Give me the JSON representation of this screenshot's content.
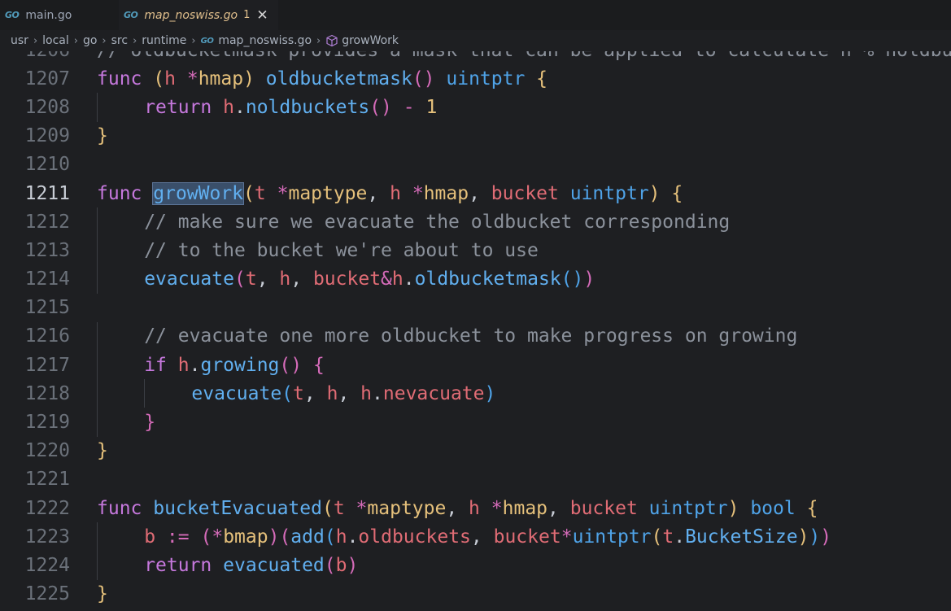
{
  "tabs": [
    {
      "icon": "go-icon",
      "label": "main.go",
      "active": false
    },
    {
      "icon": "go-icon",
      "label": "map_noswiss.go",
      "active": true,
      "badge": "1"
    }
  ],
  "breadcrumb": [
    "usr",
    "local",
    "go",
    "src",
    "runtime",
    "map_noswiss.go",
    "growWork"
  ],
  "icon_text": "GO",
  "colors": {
    "background": "#1e1f22",
    "keyword": "#c678dd",
    "function": "#61afef",
    "type": "#e5c07b",
    "param": "#e06c75",
    "comment": "#8b919b"
  },
  "code": [
    {
      "n": "1206",
      "indent": 0,
      "tokens": [
        [
          "cm",
          "// oldbucketmask provides a mask that can be applied to calculate n % noldbuckets()."
        ]
      ]
    },
    {
      "n": "1207",
      "indent": 0,
      "tokens": [
        [
          "kw",
          "func"
        ],
        [
          "df",
          " "
        ],
        [
          "p1",
          "("
        ],
        [
          "pr",
          "h"
        ],
        [
          "df",
          " "
        ],
        [
          "op",
          "*"
        ],
        [
          "ty",
          "hmap"
        ],
        [
          "p1",
          ")"
        ],
        [
          "df",
          " "
        ],
        [
          "fn",
          "oldbucketmask"
        ],
        [
          "p2",
          "()"
        ],
        [
          "df",
          " "
        ],
        [
          "kwb",
          "uintptr"
        ],
        [
          "df",
          " "
        ],
        [
          "p1",
          "{"
        ]
      ]
    },
    {
      "n": "1208",
      "indent": 1,
      "tokens": [
        [
          "kw",
          "return"
        ],
        [
          "df",
          " "
        ],
        [
          "pr",
          "h"
        ],
        [
          "df",
          "."
        ],
        [
          "fn",
          "noldbuckets"
        ],
        [
          "p2",
          "()"
        ],
        [
          "df",
          " "
        ],
        [
          "op",
          "-"
        ],
        [
          "df",
          " "
        ],
        [
          "nm",
          "1"
        ]
      ]
    },
    {
      "n": "1209",
      "indent": 0,
      "tokens": [
        [
          "p1",
          "}"
        ]
      ]
    },
    {
      "n": "1210",
      "indent": 0,
      "tokens": []
    },
    {
      "n": "1211",
      "indent": 0,
      "current": true,
      "tokens": [
        [
          "kw",
          "func"
        ],
        [
          "df",
          " "
        ],
        [
          "fn hl",
          "growWork"
        ],
        [
          "p1",
          "("
        ],
        [
          "pr",
          "t"
        ],
        [
          "df",
          " "
        ],
        [
          "op",
          "*"
        ],
        [
          "ty",
          "maptype"
        ],
        [
          "df",
          ", "
        ],
        [
          "pr",
          "h"
        ],
        [
          "df",
          " "
        ],
        [
          "op",
          "*"
        ],
        [
          "ty",
          "hmap"
        ],
        [
          "df",
          ", "
        ],
        [
          "pr",
          "bucket"
        ],
        [
          "df",
          " "
        ],
        [
          "kwb",
          "uintptr"
        ],
        [
          "p1",
          ")"
        ],
        [
          "df",
          " "
        ],
        [
          "p1",
          "{"
        ]
      ]
    },
    {
      "n": "1212",
      "indent": 1,
      "tokens": [
        [
          "cm",
          "// make sure we evacuate the oldbucket corresponding"
        ]
      ]
    },
    {
      "n": "1213",
      "indent": 1,
      "tokens": [
        [
          "cm",
          "// to the bucket we're about to use"
        ]
      ]
    },
    {
      "n": "1214",
      "indent": 1,
      "tokens": [
        [
          "fn",
          "evacuate"
        ],
        [
          "p2",
          "("
        ],
        [
          "pr",
          "t"
        ],
        [
          "df",
          ", "
        ],
        [
          "pr",
          "h"
        ],
        [
          "df",
          ", "
        ],
        [
          "pr",
          "bucket"
        ],
        [
          "op",
          "&"
        ],
        [
          "pr",
          "h"
        ],
        [
          "df",
          "."
        ],
        [
          "fn",
          "oldbucketmask"
        ],
        [
          "p3",
          "()"
        ],
        [
          "p2",
          ")"
        ]
      ]
    },
    {
      "n": "1215",
      "indent": 0,
      "tokens": []
    },
    {
      "n": "1216",
      "indent": 1,
      "tokens": [
        [
          "cm",
          "// evacuate one more oldbucket to make progress on growing"
        ]
      ]
    },
    {
      "n": "1217",
      "indent": 1,
      "tokens": [
        [
          "kw",
          "if"
        ],
        [
          "df",
          " "
        ],
        [
          "pr",
          "h"
        ],
        [
          "df",
          "."
        ],
        [
          "fn",
          "growing"
        ],
        [
          "p2",
          "()"
        ],
        [
          "df",
          " "
        ],
        [
          "p2",
          "{"
        ]
      ]
    },
    {
      "n": "1218",
      "indent": 2,
      "tokens": [
        [
          "fn",
          "evacuate"
        ],
        [
          "p3",
          "("
        ],
        [
          "pr",
          "t"
        ],
        [
          "df",
          ", "
        ],
        [
          "pr",
          "h"
        ],
        [
          "df",
          ", "
        ],
        [
          "pr",
          "h"
        ],
        [
          "df",
          "."
        ],
        [
          "pr",
          "nevacuate"
        ],
        [
          "p3",
          ")"
        ]
      ]
    },
    {
      "n": "1219",
      "indent": 1,
      "tokens": [
        [
          "p2",
          "}"
        ]
      ]
    },
    {
      "n": "1220",
      "indent": 0,
      "tokens": [
        [
          "p1",
          "}"
        ]
      ]
    },
    {
      "n": "1221",
      "indent": 0,
      "tokens": []
    },
    {
      "n": "1222",
      "indent": 0,
      "tokens": [
        [
          "kw",
          "func"
        ],
        [
          "df",
          " "
        ],
        [
          "fn",
          "bucketEvacuated"
        ],
        [
          "p1",
          "("
        ],
        [
          "pr",
          "t"
        ],
        [
          "df",
          " "
        ],
        [
          "op",
          "*"
        ],
        [
          "ty",
          "maptype"
        ],
        [
          "df",
          ", "
        ],
        [
          "pr",
          "h"
        ],
        [
          "df",
          " "
        ],
        [
          "op",
          "*"
        ],
        [
          "ty",
          "hmap"
        ],
        [
          "df",
          ", "
        ],
        [
          "pr",
          "bucket"
        ],
        [
          "df",
          " "
        ],
        [
          "kwb",
          "uintptr"
        ],
        [
          "p1",
          ")"
        ],
        [
          "df",
          " "
        ],
        [
          "kwb",
          "bool"
        ],
        [
          "df",
          " "
        ],
        [
          "p1",
          "{"
        ]
      ]
    },
    {
      "n": "1223",
      "indent": 1,
      "tokens": [
        [
          "pr",
          "b"
        ],
        [
          "df",
          " "
        ],
        [
          "op",
          ":="
        ],
        [
          "df",
          " "
        ],
        [
          "p2",
          "("
        ],
        [
          "op",
          "*"
        ],
        [
          "ty",
          "bmap"
        ],
        [
          "p2",
          ")"
        ],
        [
          "p2",
          "("
        ],
        [
          "fn",
          "add"
        ],
        [
          "p3",
          "("
        ],
        [
          "pr",
          "h"
        ],
        [
          "df",
          "."
        ],
        [
          "pr",
          "oldbuckets"
        ],
        [
          "df",
          ", "
        ],
        [
          "pr",
          "bucket"
        ],
        [
          "op",
          "*"
        ],
        [
          "kwb",
          "uintptr"
        ],
        [
          "p1",
          "("
        ],
        [
          "pr",
          "t"
        ],
        [
          "df",
          "."
        ],
        [
          "fn",
          "BucketSize"
        ],
        [
          "p1",
          ")"
        ],
        [
          "p3",
          ")"
        ],
        [
          "p2",
          ")"
        ]
      ]
    },
    {
      "n": "1224",
      "indent": 1,
      "tokens": [
        [
          "kw",
          "return"
        ],
        [
          "df",
          " "
        ],
        [
          "fn",
          "evacuated"
        ],
        [
          "p2",
          "("
        ],
        [
          "pr",
          "b"
        ],
        [
          "p2",
          ")"
        ]
      ]
    },
    {
      "n": "1225",
      "indent": 0,
      "tokens": [
        [
          "p1",
          "}"
        ]
      ]
    }
  ]
}
